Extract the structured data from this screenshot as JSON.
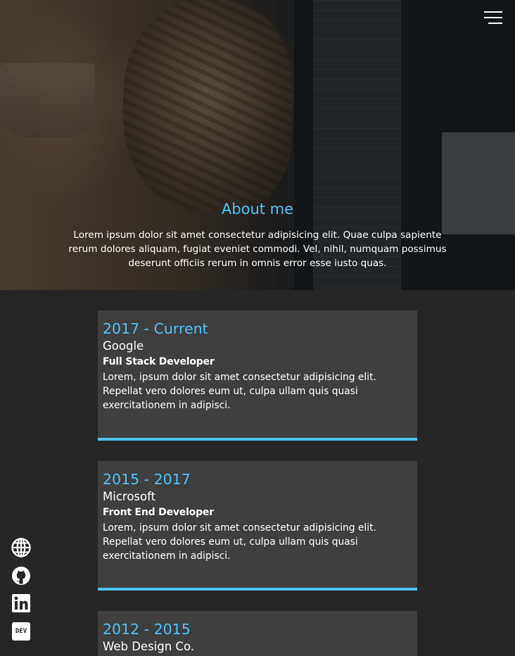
{
  "nav": {
    "menu_icon": "hamburger-icon"
  },
  "about": {
    "title": "About me",
    "text": "Lorem ipsum dolor sit amet consectetur adipisicing elit. Quae culpa sapiente rerum dolores aliquam, fugiat eveniet commodi. Vel, nihil, numquam possimus deserunt officiis rerum in omnis error esse iusto quas."
  },
  "experience": [
    {
      "period": "2017 - Current",
      "company": "Google",
      "role": "Full Stack Developer",
      "description": "Lorem, ipsum dolor sit amet consectetur adipisicing elit. Repellat vero dolores eum ut, culpa ullam quis quasi exercitationem in adipisci."
    },
    {
      "period": "2015 - 2017",
      "company": "Microsoft",
      "role": "Front End Developer",
      "description": "Lorem, ipsum dolor sit amet consectetur adipisicing elit. Repellat vero dolores eum ut, culpa ullam quis quasi exercitationem in adipisci."
    },
    {
      "period": "2012 - 2015",
      "company": "Web Design Co.",
      "role": "",
      "description": ""
    }
  ],
  "social": {
    "website_icon": "globe-icon",
    "github_icon": "github-icon",
    "linkedin_icon": "linkedin-icon",
    "dev_label": "DEV"
  },
  "colors": {
    "accent": "#4fc3f7",
    "background": "#262626",
    "card": "#3f3f3f",
    "text": "#ffffff"
  }
}
